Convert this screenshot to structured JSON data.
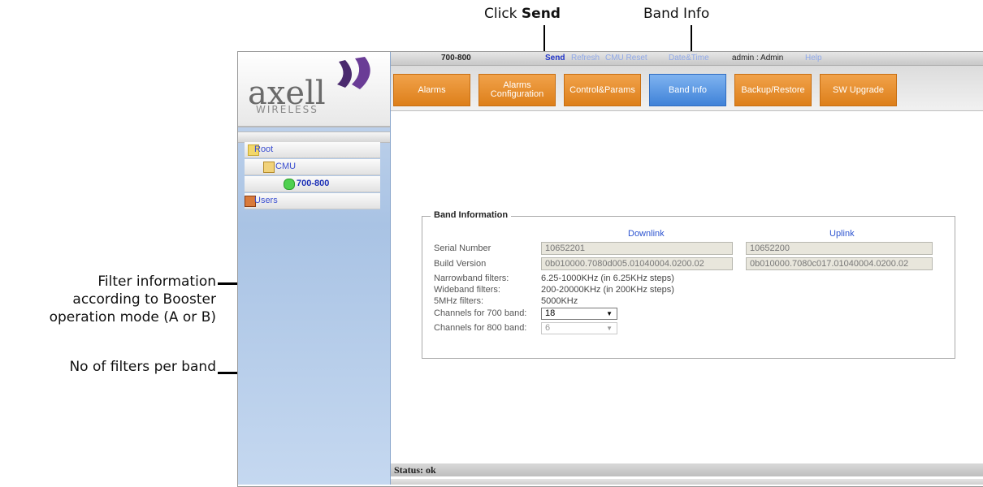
{
  "callouts": {
    "click_prefix": "Click ",
    "click_bold": "Send",
    "band_info": "Band Info",
    "filter_line1": "Filter information",
    "filter_line2": "according to Booster",
    "filter_line3": "operation mode (A or B)",
    "filters_per_band": "No of filters per band"
  },
  "logo": {
    "brand": "axell",
    "sub": "WIRELESS"
  },
  "tree": {
    "root": "Root",
    "cmu": "CMU",
    "node": "700-800",
    "users": "Users"
  },
  "topbar": {
    "device": "700-800",
    "send": "Send",
    "refresh": "Refresh",
    "cmu_reset": "CMU Reset",
    "date_time": "Date&Time",
    "user": "admin : Admin",
    "help": "Help"
  },
  "tabs": {
    "alarms": "Alarms",
    "alarms_config_1": "Alarms",
    "alarms_config_2": "Configuration",
    "control": "Control&Params",
    "band_info": "Band Info",
    "backup": "Backup/Restore",
    "sw_upgrade": "SW Upgrade"
  },
  "band_info": {
    "legend": "Band Information",
    "downlink": "Downlink",
    "uplink": "Uplink",
    "serial_label": "Serial Number",
    "serial_dl": "10652201",
    "serial_ul": "10652200",
    "build_label": "Build Version",
    "build_dl": "0b010000.7080d005.01040004.0200.02",
    "build_ul": "0b010000.7080c017.01040004.0200.02",
    "narrow_label": "Narrowband filters:",
    "narrow_val": "6.25-1000KHz (in 6.25KHz steps)",
    "wide_label": "Wideband filters:",
    "wide_val": "200-20000KHz (in 200KHz steps)",
    "fivemhz_label": "5MHz filters:",
    "fivemhz_val": "5000KHz",
    "ch700_label": "Channels for 700 band:",
    "ch700_val": "18",
    "ch800_label": "Channels for 800 band:",
    "ch800_val": "6"
  },
  "status": "Status: ok",
  "colors": {
    "tab_orange": "#e08a2a",
    "tab_active": "#4f8fdc",
    "link_blue": "#2d54d0"
  }
}
